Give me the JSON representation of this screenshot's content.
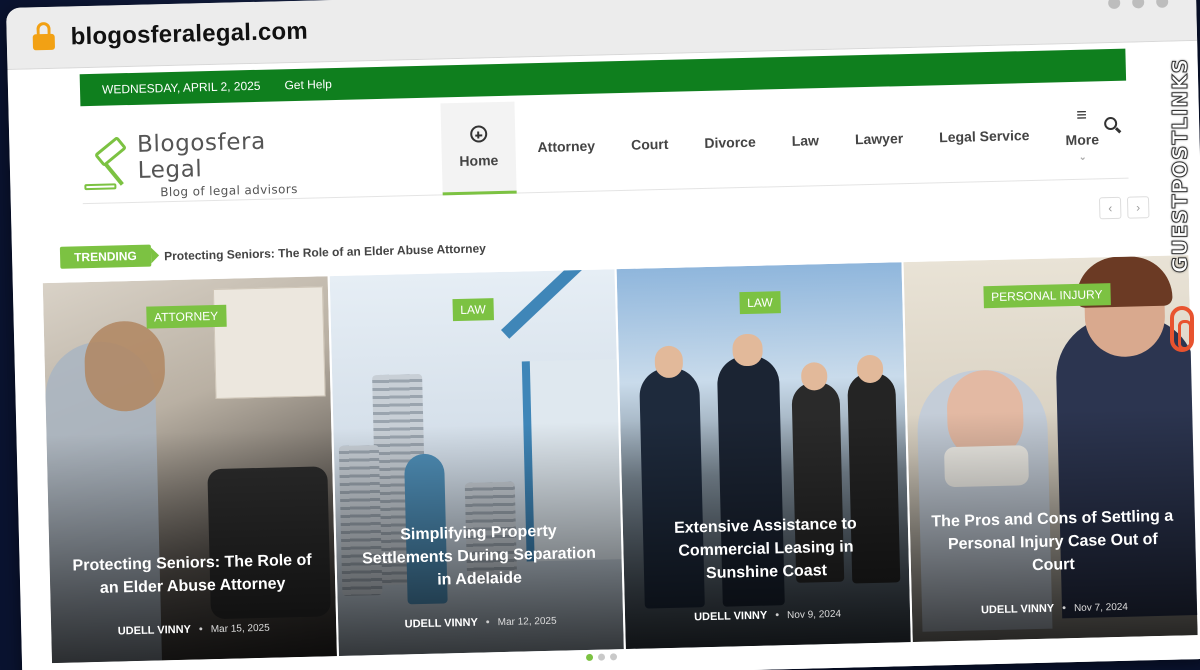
{
  "browser": {
    "url": "blogosferalegal.com"
  },
  "topbar": {
    "date": "WEDNESDAY, APRIL 2, 2025",
    "help_link": "Get Help"
  },
  "logo": {
    "title": "Blogosfera Legal",
    "subtitle": "Blog of legal advisors"
  },
  "nav": {
    "home": "Home",
    "items": [
      "Attorney",
      "Court",
      "Divorce",
      "Law",
      "Lawyer",
      "Legal Service"
    ],
    "more": "More"
  },
  "trending": {
    "badge": "TRENDING",
    "headline": "Protecting Seniors: The Role of an Elder Abuse Attorney"
  },
  "cards": [
    {
      "category": "ATTORNEY",
      "title": "Protecting Seniors: The Role of an Elder Abuse Attorney",
      "author": "UDELL VINNY",
      "date": "Mar 15, 2025"
    },
    {
      "category": "LAW",
      "title": "Simplifying Property Settlements During Separation in Adelaide",
      "author": "UDELL VINNY",
      "date": "Mar 12, 2025"
    },
    {
      "category": "LAW",
      "title": "Extensive Assistance to Commercial Leasing in Sunshine Coast",
      "author": "UDELL VINNY",
      "date": "Nov 9, 2024"
    },
    {
      "category": "PERSONAL INJURY",
      "title": "The Pros and Cons of Settling a Personal Injury Case Out of Court",
      "author": "UDELL VINNY",
      "date": "Nov 7, 2024"
    }
  ],
  "slider": {
    "pages": 3,
    "active": 1
  },
  "side_brand": {
    "text": "GUESTPOSTLINKS"
  },
  "colors": {
    "topbar_green": "#0f7f1e",
    "accent_green": "#7cc242",
    "lock_orange": "#f2a114",
    "brand_red": "#e8532f"
  }
}
